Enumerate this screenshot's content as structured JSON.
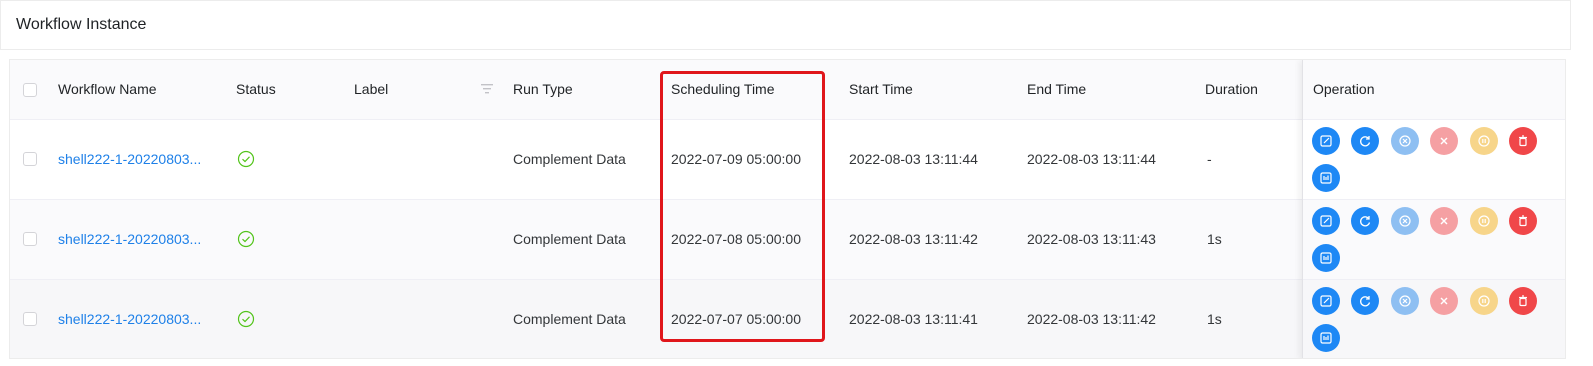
{
  "page": {
    "title": "Workflow Instance"
  },
  "table": {
    "columns": {
      "name": "Workflow Name",
      "status": "Status",
      "label": "Label",
      "run_type": "Run Type",
      "scheduling_time": "Scheduling Time",
      "start_time": "Start Time",
      "end_time": "End Time",
      "duration": "Duration",
      "operation": "Operation"
    },
    "rows": [
      {
        "name": "shell222-1-20220803...",
        "status": "success",
        "label": "",
        "run_type": "Complement Data",
        "scheduling_time": "2022-07-09 05:00:00",
        "start_time": "2022-08-03 13:11:44",
        "end_time": "2022-08-03 13:11:44",
        "duration": "-"
      },
      {
        "name": "shell222-1-20220803...",
        "status": "success",
        "label": "",
        "run_type": "Complement Data",
        "scheduling_time": "2022-07-08 05:00:00",
        "start_time": "2022-08-03 13:11:42",
        "end_time": "2022-08-03 13:11:43",
        "duration": "1s"
      },
      {
        "name": "shell222-1-20220803...",
        "status": "success",
        "label": "",
        "run_type": "Complement Data",
        "scheduling_time": "2022-07-07 05:00:00",
        "start_time": "2022-08-03 13:11:41",
        "end_time": "2022-08-03 13:11:42",
        "duration": "1s"
      }
    ],
    "operations": [
      "edit-icon",
      "rerun-icon",
      "recover-failed-icon",
      "stop-icon",
      "pause-icon",
      "delete-icon",
      "gantt-icon"
    ]
  },
  "colors": {
    "link": "#1e80e8",
    "status_success": "#52c41a",
    "highlight": "#e0161b",
    "op_primary": "#1e88f5",
    "op_disabled_blue": "#8ebff2",
    "op_disabled_red": "#f5a0a3",
    "op_disabled_yellow": "#f7d58a",
    "op_danger": "#f04749"
  }
}
